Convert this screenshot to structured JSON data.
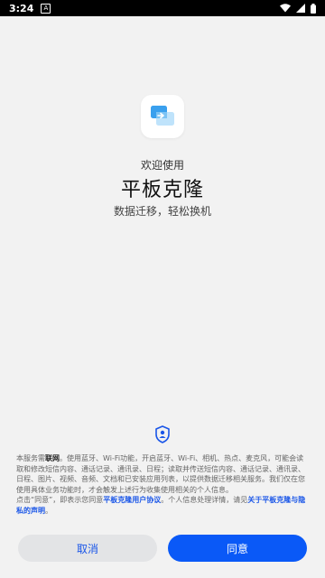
{
  "status_bar": {
    "time": "3:24",
    "notification_icon": "A",
    "icons": [
      "wifi-icon",
      "signal-icon",
      "battery-icon"
    ]
  },
  "app": {
    "icon": "clone-app-icon",
    "welcome": "欢迎使用",
    "title": "平板克隆",
    "subtitle": "数据迁移，轻松换机"
  },
  "notice": {
    "icon": "shield-user-icon",
    "p1_prefix": "本服务需",
    "p1_bold": "联网",
    "p1_rest": "。使用蓝牙、Wi-Fi功能，开启蓝牙、Wi-Fi、相机、热点、麦克风，可能会读取和修改短信内容、通话记录、通讯录、日程；读取并传送短信内容、通话记录、通讯录、日程、图片、视频、音频、文档和已安装应用列表，以提供数据迁移相关服务。我们仅在您使用具体业务功能时，才会触发上述行为收集使用相关的个人信息。",
    "p2_prefix": "点击“同意”，即表示您同意",
    "p2_link1": "平板克隆用户协议",
    "p2_mid": "。个人信息处理详情，请见",
    "p2_link2": "关于平板克隆与隐私的声明",
    "p2_end": "。"
  },
  "buttons": {
    "cancel": "取消",
    "agree": "同意"
  },
  "colors": {
    "accent": "#0a59f7",
    "link": "#1a56e8",
    "background": "#f2f2f2"
  }
}
